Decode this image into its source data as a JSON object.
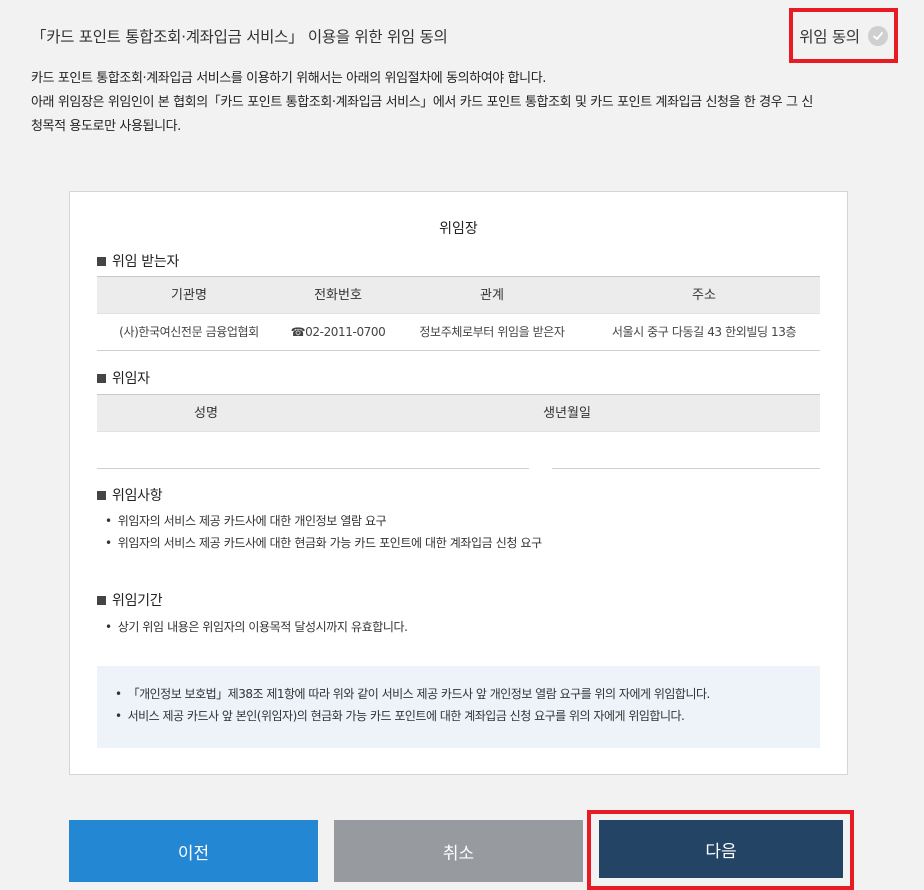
{
  "header": {
    "title": "「카드 포인트 통합조회·계좌입금 서비스」 이용을 위한 위임 동의",
    "agree_label": "위임 동의"
  },
  "description": {
    "line1": "카드 포인트 통합조회·계좌입금 서비스를 이용하기 위해서는 아래의 위임절차에 동의하여야 합니다.",
    "line2": "아래 위임장은 위임인이 본 협회의「카드 포인트 통합조회·계좌입금 서비스」에서 카드 포인트 통합조회 및 카드 포인트 계좌입금 신청을 한 경우 그 신",
    "line3": "청목적 용도로만 사용됩니다."
  },
  "document": {
    "title": "위임장",
    "recipient": {
      "heading": "위임 받는자",
      "columns": [
        "기관명",
        "전화번호",
        "관계",
        "주소"
      ],
      "row": {
        "org": "(사)한국여신전문 금융업협회",
        "phone_icon": "☎",
        "phone": "02-2011-0700",
        "relation": "정보주체로부터 위임을 받은자",
        "address": "서울시 중구 다동길 43 한외빌딩 13층"
      }
    },
    "grantor": {
      "heading": "위임자",
      "columns": [
        "성명",
        "생년월일"
      ]
    },
    "matters": {
      "heading": "위임사항",
      "items": [
        "위임자의 서비스 제공 카드사에 대한 개인정보 열람 요구",
        "위임자의 서비스 제공 카드사에 대한 현금화 가능 카드 포인트에 대한 계좌입금 신청 요구"
      ]
    },
    "period": {
      "heading": "위임기간",
      "items": [
        "상기 위임 내용은 위임자의 이용목적 달성시까지 유효합니다."
      ]
    },
    "notice": {
      "items": [
        "「개인정보 보호법」제38조 제1항에 따라 위와 같이 서비스 제공 카드사 앞 개인정보 열람 요구를 위의 자에게 위임합니다.",
        "서비스 제공 카드사 앞 본인(위임자)의 현금화 가능 카드 포인트에 대한 계좌입금 신청 요구를 위의 자에게 위임합니다."
      ]
    }
  },
  "buttons": {
    "prev": "이전",
    "cancel": "취소",
    "next": "다음"
  },
  "colors": {
    "prev": "#2487d4",
    "cancel": "#979b9f",
    "next": "#244466",
    "highlight": "#e81b24"
  }
}
